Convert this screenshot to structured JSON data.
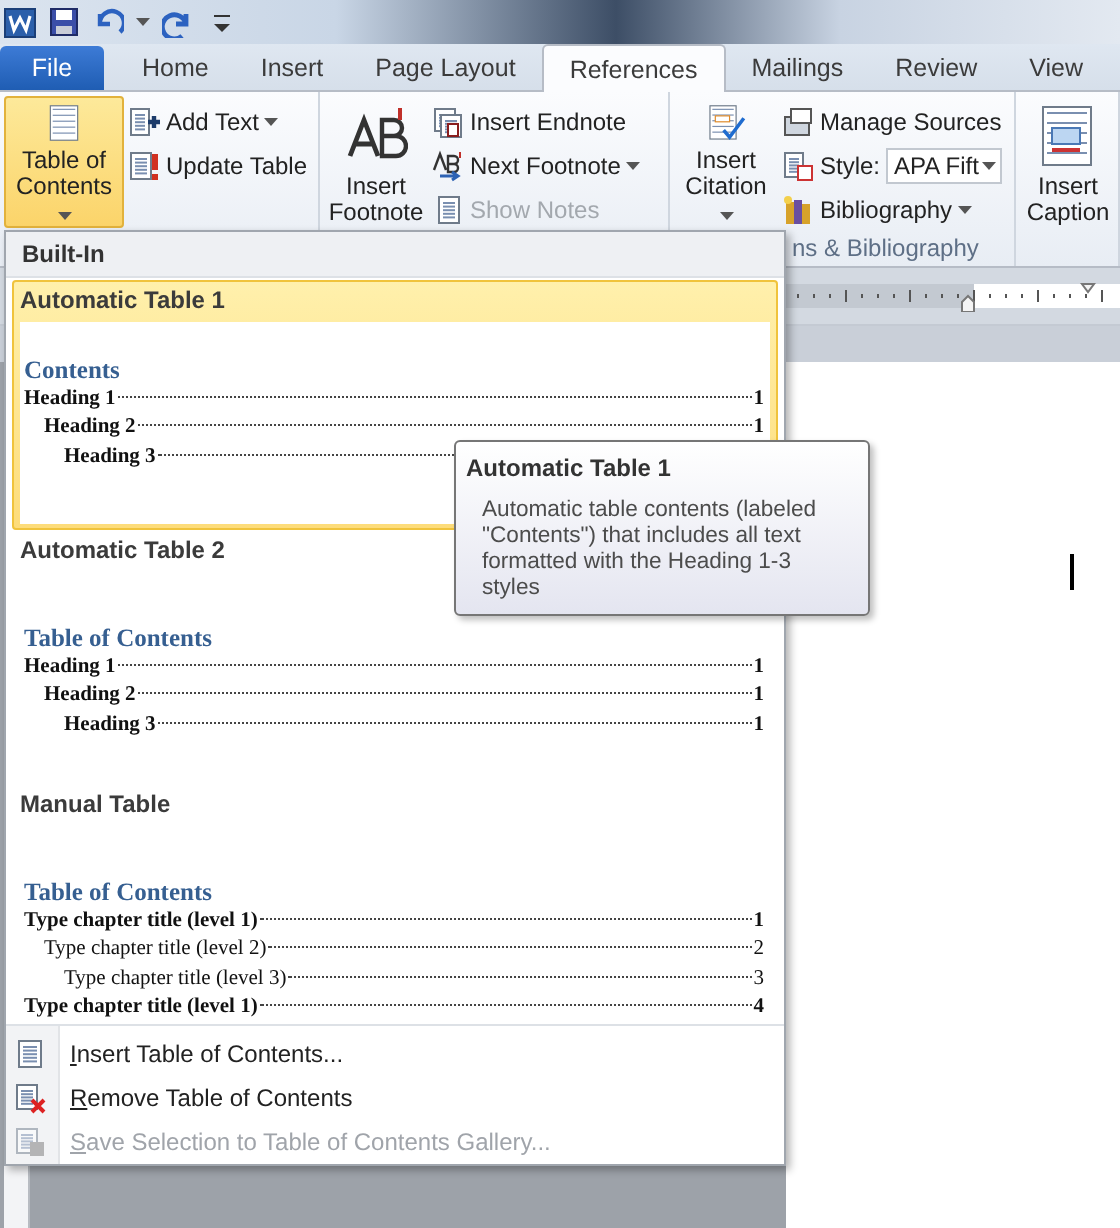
{
  "tabs": [
    {
      "label": "File",
      "kind": "file",
      "selected": false
    },
    {
      "label": "Home",
      "kind": "tab",
      "selected": false
    },
    {
      "label": "Insert",
      "kind": "tab",
      "selected": false
    },
    {
      "label": "Page Layout",
      "kind": "tab",
      "selected": false
    },
    {
      "label": "References",
      "kind": "tab",
      "selected": true
    },
    {
      "label": "Mailings",
      "kind": "tab",
      "selected": false
    },
    {
      "label": "Review",
      "kind": "tab",
      "selected": false
    },
    {
      "label": "View",
      "kind": "tab",
      "selected": false
    }
  ],
  "ribbon": {
    "toc_button": {
      "label": "Table of Contents",
      "active": true
    },
    "add_text": "Add Text",
    "update_table": "Update Table",
    "insert_footnote": "Insert Footnote",
    "insert_endnote": "Insert Endnote",
    "next_footnote": "Next Footnote",
    "show_notes": {
      "label": "Show Notes",
      "disabled": true
    },
    "insert_citation": "Insert Citation",
    "manage_sources": "Manage Sources",
    "style": {
      "label": "Style:",
      "value": "APA Fift"
    },
    "bibliography": "Bibliography",
    "citations_group_label": "ns & Bibliography",
    "insert_caption": "Insert Caption"
  },
  "toc_menu": {
    "section": "Built-In",
    "gallery": [
      {
        "title": "Automatic Table 1",
        "kind": "automatic",
        "selected": true,
        "heading": "Contents",
        "entries": [
          {
            "text": "Heading 1",
            "page": "1",
            "children": [
              {
                "text": "Heading 2",
                "page": "1",
                "children": [
                  {
                    "text": "Heading 3"
                  }
                ]
              }
            ]
          }
        ]
      },
      {
        "title": "Automatic Table 2",
        "kind": "automatic",
        "selected": false,
        "heading": "Table of Contents",
        "entries": [
          {
            "text": "Heading 1",
            "page": "1",
            "children": [
              {
                "text": "Heading 2",
                "page": "1",
                "children": [
                  {
                    "text": "Heading 3",
                    "page": "1"
                  }
                ]
              }
            ]
          }
        ]
      },
      {
        "title": "Manual Table",
        "kind": "manual",
        "selected": false,
        "heading": "Table of Contents",
        "entries": [
          {
            "text": "Type chapter title (level 1)",
            "page": "1",
            "children": [
              {
                "text": "Type chapter title (level 2)",
                "page": "2",
                "children": [
                  {
                    "text": "Type chapter title (level 3)",
                    "page": "3"
                  }
                ]
              }
            ]
          },
          {
            "text": "Type chapter title (level 1)",
            "page": "4"
          }
        ]
      }
    ],
    "commands": [
      {
        "label": "Insert Table of Contents...",
        "disabled": false
      },
      {
        "label": "Remove Table of Contents",
        "disabled": false
      },
      {
        "label": "Save Selection to Table of Contents Gallery...",
        "disabled": true
      }
    ]
  },
  "tooltip": {
    "title": "Automatic Table 1",
    "body": "Automatic table contents (labeled \"Contents\") that includes all text formatted with the Heading 1-3 styles"
  }
}
